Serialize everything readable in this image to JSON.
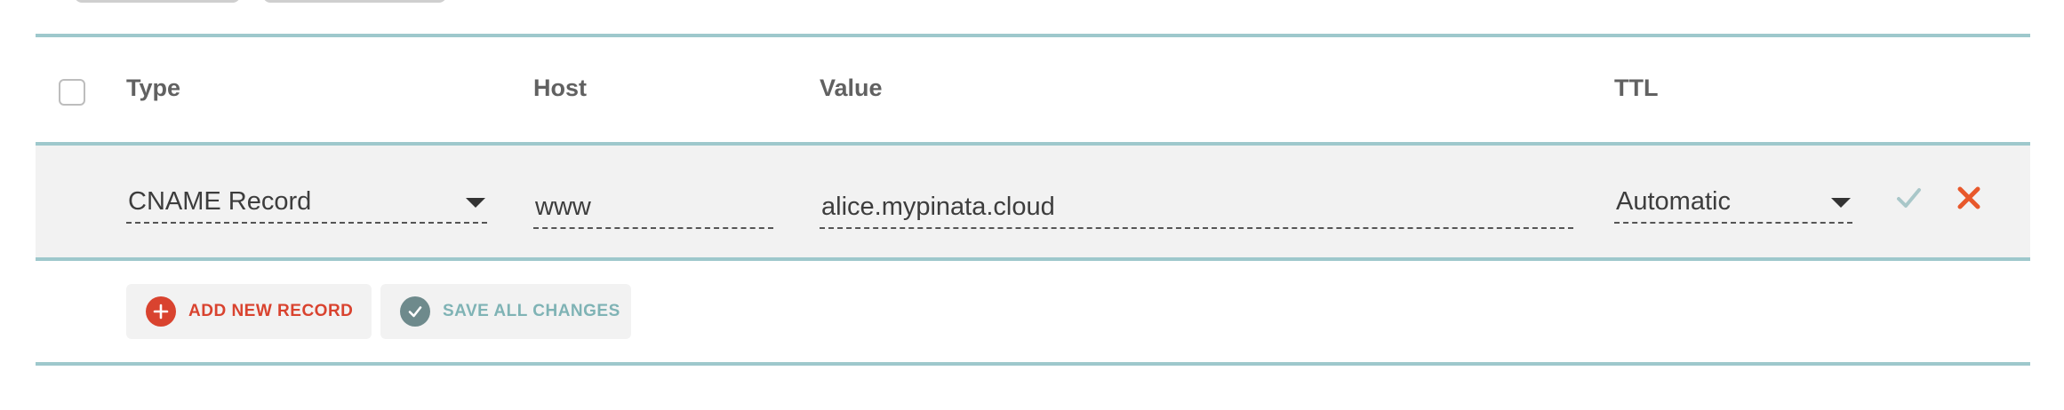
{
  "table": {
    "headers": {
      "type": "Type",
      "host": "Host",
      "value": "Value",
      "ttl": "TTL"
    },
    "edit_row": {
      "type": "CNAME Record",
      "host": "www",
      "value": "alice.mypinata.cloud",
      "ttl": "Automatic"
    }
  },
  "actions": {
    "add_label": "ADD NEW RECORD",
    "save_label": "SAVE ALL CHANGES"
  },
  "colors": {
    "rule": "#9ec8cc",
    "add_red": "#d9432f",
    "save_teal": "#7fb3b5",
    "save_icon": "#6e8a8c",
    "cancel_orange": "#e8582b",
    "confirm_check": "#a9c7c9"
  }
}
